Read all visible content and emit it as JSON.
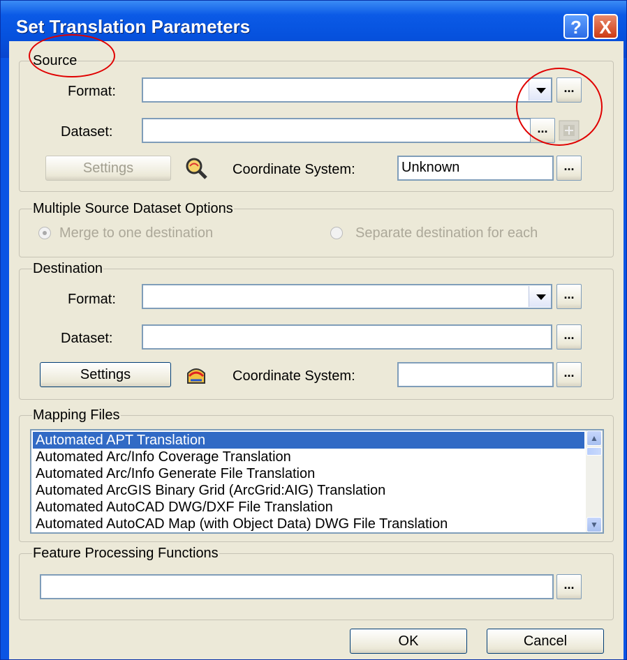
{
  "window": {
    "title": "Set Translation Parameters",
    "help_label": "?",
    "close_label": "X"
  },
  "source": {
    "group_label": "Source",
    "format_label": "Format:",
    "format_value": "",
    "dataset_label": "Dataset:",
    "dataset_value": "",
    "browse_label": "...",
    "settings_label": "Settings",
    "coord_label": "Coordinate System:",
    "coord_value": "Unknown"
  },
  "multiple": {
    "group_label": "Multiple Source Dataset Options",
    "merge_label": "Merge to one destination",
    "separate_label": "Separate destination for each",
    "selected": "merge"
  },
  "destination": {
    "group_label": "Destination",
    "format_label": "Format:",
    "format_value": "",
    "dataset_label": "Dataset:",
    "dataset_value": "",
    "settings_label": "Settings",
    "coord_label": "Coordinate System:",
    "coord_value": ""
  },
  "mapping": {
    "group_label": "Mapping Files",
    "items": [
      "Automated APT Translation",
      "Automated Arc/Info Coverage Translation",
      "Automated Arc/Info Generate File Translation",
      "Automated ArcGIS Binary Grid (ArcGrid:AIG) Translation",
      "Automated AutoCAD DWG/DXF File Translation",
      "Automated AutoCAD Map (with Object Data) DWG File Translation"
    ],
    "selected_index": 0
  },
  "feature": {
    "group_label": "Feature Processing Functions",
    "value": ""
  },
  "footer": {
    "ok_label": "OK",
    "cancel_label": "Cancel"
  },
  "colors": {
    "selection": "#316ac5",
    "title_bar": "#0a54e4",
    "annotation": "#e00000"
  }
}
